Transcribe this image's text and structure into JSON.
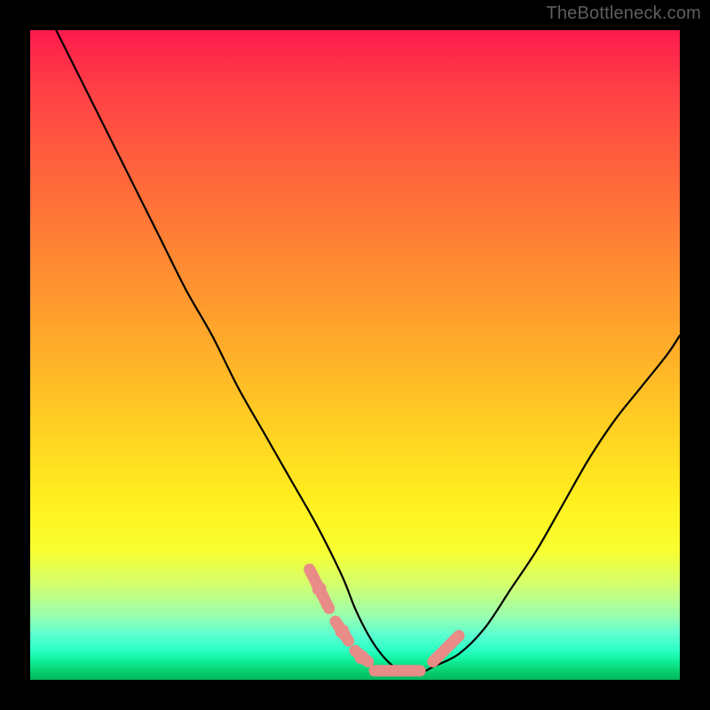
{
  "watermark": "TheBottleneck.com",
  "colors": {
    "frame": "#000000",
    "curve": "#000000",
    "highlight": "#e98b87",
    "gradient": [
      "#ff1a4d",
      "#ff3b47",
      "#ff5a3f",
      "#ff7a36",
      "#ff9a2e",
      "#ffbb27",
      "#ffd821",
      "#fff01f",
      "#f8ff2f",
      "#d6ff6a",
      "#9cffad",
      "#5cffd0",
      "#2affc4",
      "#11f09a",
      "#0cdc7f",
      "#05c96a",
      "#03b95c"
    ]
  },
  "chart_data": {
    "type": "line",
    "title": "",
    "xlabel": "",
    "ylabel": "",
    "xlim": [
      0,
      100
    ],
    "ylim": [
      0,
      100
    ],
    "series": [
      {
        "name": "bottleneck-curve",
        "x": [
          4,
          8,
          12,
          16,
          20,
          24,
          28,
          32,
          36,
          40,
          44,
          48,
          50,
          52,
          54,
          56,
          58,
          60,
          62,
          66,
          70,
          74,
          78,
          82,
          86,
          90,
          94,
          98,
          100
        ],
        "y": [
          100,
          92,
          84,
          76,
          68,
          60,
          53,
          45,
          38,
          31,
          24,
          16,
          11,
          7,
          4,
          2,
          1,
          1,
          2,
          4,
          8,
          14,
          20,
          27,
          34,
          40,
          45,
          50,
          53
        ]
      }
    ],
    "highlight_segments": [
      {
        "name": "left-upper",
        "x": [
          43,
          46
        ],
        "y": [
          17,
          11
        ]
      },
      {
        "name": "left-mid",
        "x": [
          47,
          49
        ],
        "y": [
          9,
          6
        ]
      },
      {
        "name": "left-lower",
        "x": [
          50,
          52
        ],
        "y": [
          4.5,
          2.8
        ]
      },
      {
        "name": "flat-bottom",
        "x": [
          53,
          60
        ],
        "y": [
          1.4,
          1.4
        ]
      },
      {
        "name": "right-rise",
        "x": [
          62,
          66
        ],
        "y": [
          2.8,
          6.8
        ]
      }
    ],
    "highlight_points": [
      {
        "x": 44.5,
        "y": 14
      },
      {
        "x": 48,
        "y": 7.5
      },
      {
        "x": 51,
        "y": 3.5
      }
    ]
  }
}
